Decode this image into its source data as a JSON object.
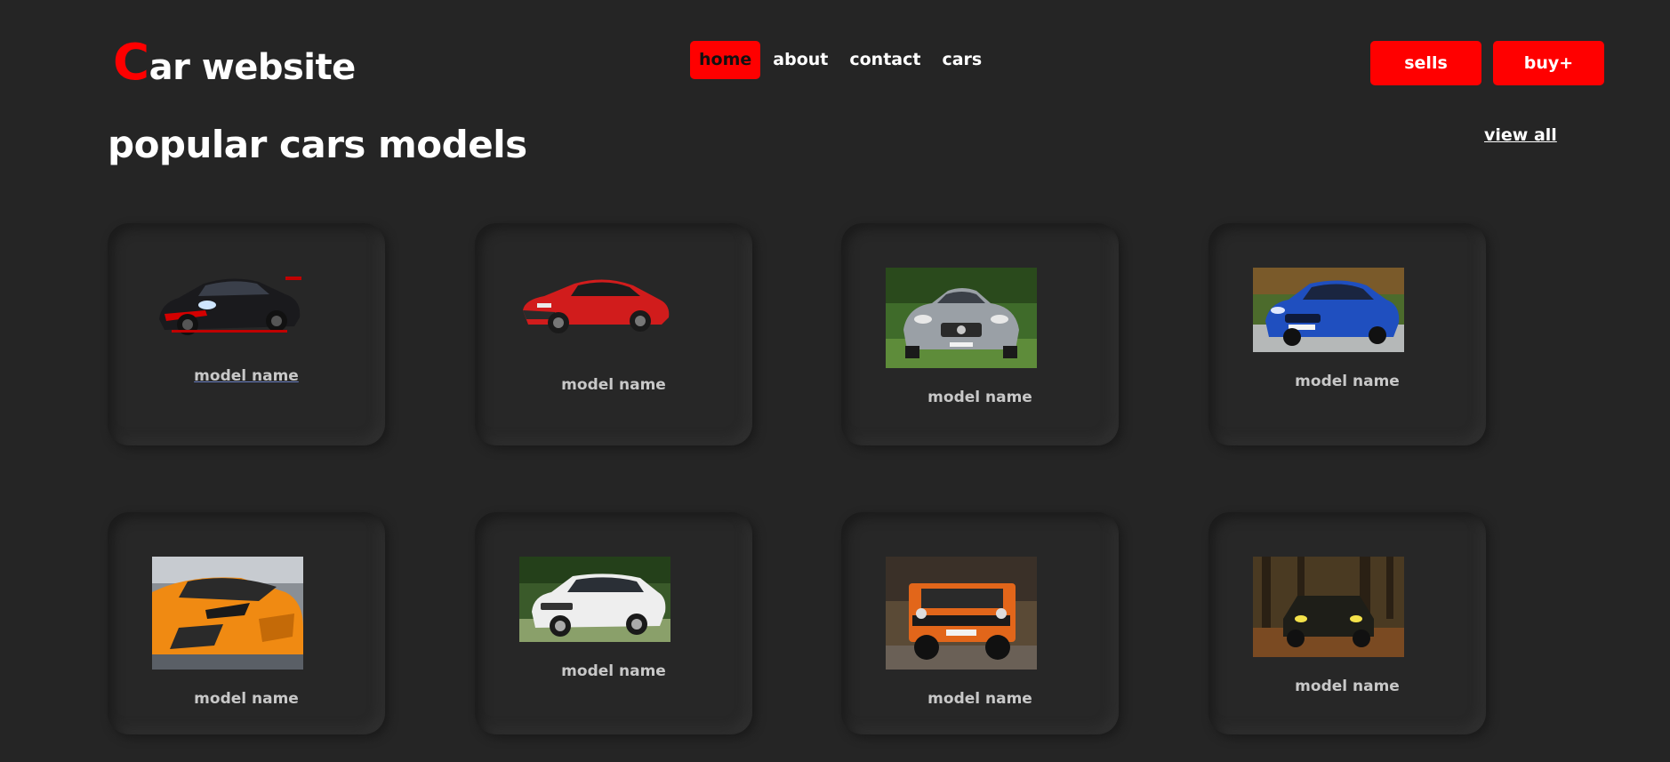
{
  "header": {
    "logo_first": "C",
    "logo_rest": "ar website",
    "nav": [
      "home",
      "about",
      "contact",
      "cars"
    ],
    "sells_label": "sells",
    "buy_label": "buy+"
  },
  "section": {
    "title": "popular cars models",
    "view_all": "view all"
  },
  "cards": [
    {
      "model": "model name",
      "image": "black-sports-car"
    },
    {
      "model": "model name",
      "image": "red-bmw-i8"
    },
    {
      "model": "model name",
      "image": "silver-mercedes-amg-gt"
    },
    {
      "model": "model name",
      "image": "blue-bmw-sedan"
    },
    {
      "model": "model name",
      "image": "orange-lamborghini"
    },
    {
      "model": "model name",
      "image": "white-range-rover-evoque"
    },
    {
      "model": "model name",
      "image": "orange-mercedes-g-class"
    },
    {
      "model": "model name",
      "image": "offroad-truck-forest"
    }
  ],
  "colors": {
    "background": "#252525",
    "accent": "#ff0000",
    "text": "#ffffff",
    "model_text": "#c8c8c8"
  }
}
